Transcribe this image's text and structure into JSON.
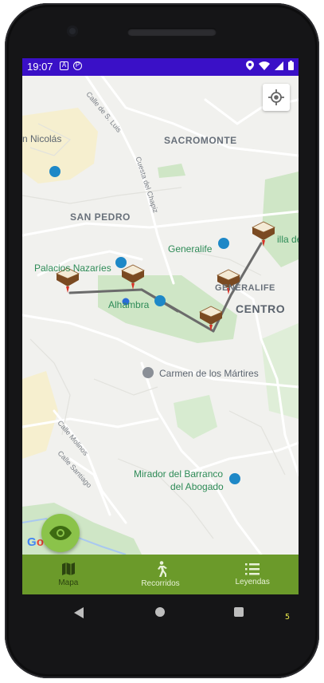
{
  "status_bar": {
    "time": "19:07",
    "icons": [
      "a-icon",
      "p-icon"
    ],
    "right_icons": [
      "location-icon",
      "wifi-icon",
      "signal-icon",
      "battery-icon"
    ]
  },
  "map": {
    "labels": {
      "san_nicolas": "n Nicolás",
      "calle_san_luis": "Calle de S. Luis",
      "sacromonte": "SACROMONTE",
      "cuesta_chapiz": "Cuesta del Chapiz",
      "san_pedro": "SAN PEDRO",
      "generalife_place": "Generalife",
      "palacios_nazaries": "Palacios Nazaríes",
      "alhambra": "Alhambra",
      "generalife_area": "GENERALIFE",
      "centro": "CENTRO",
      "silla": "illa de",
      "carmen_martires": "Carmen de los Mártires",
      "calle_molinos": "Calle Molinos",
      "calle_santiago": "Calle Santiago",
      "mirador_1": "Mirador del Barranco",
      "mirador_2": "del Abogado"
    },
    "google_logo": "Google",
    "locate_button": "my-location-icon",
    "fab_icon": "eye-icon"
  },
  "bottom_nav": {
    "items": [
      {
        "label": "Mapa",
        "icon": "map-icon",
        "active": true
      },
      {
        "label": "Recorridos",
        "icon": "walk-icon",
        "active": false
      },
      {
        "label": "Leyendas",
        "icon": "list-icon",
        "active": false
      }
    ]
  },
  "system_nav": {
    "corner_digit": "5"
  },
  "colors": {
    "status_bar": "#3a10c7",
    "bottom_nav": "#6b9a2a",
    "fab": "#8bc34a",
    "route": "#6b6b6b"
  }
}
